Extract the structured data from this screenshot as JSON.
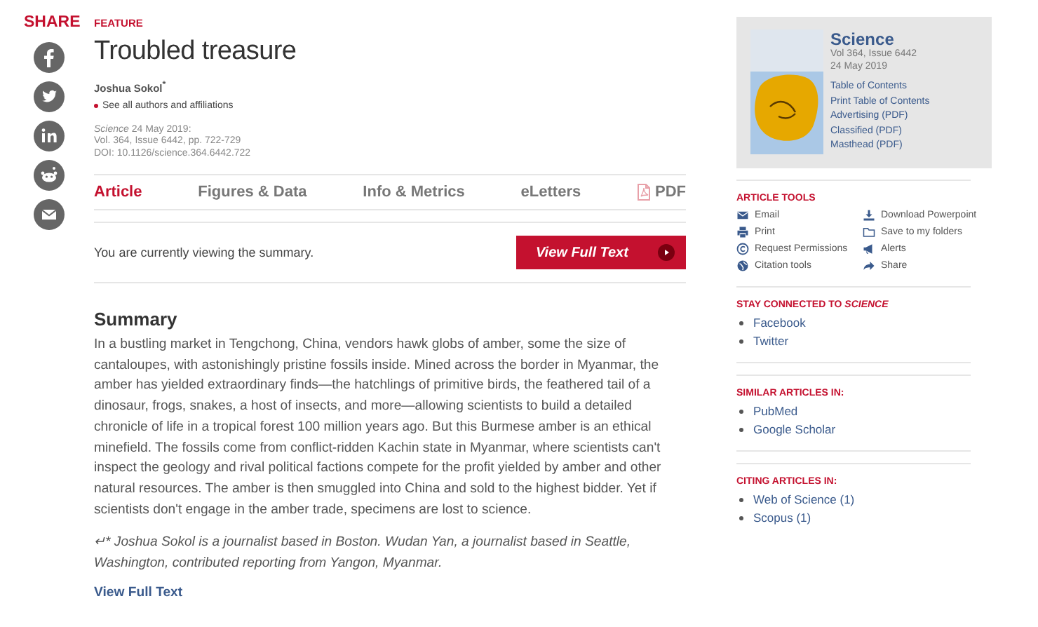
{
  "share": {
    "title": "SHARE"
  },
  "article": {
    "label": "FEATURE",
    "title": "Troubled treasure",
    "author": "Joshua Sokol$^{*}$",
    "affiliations_link": "See all authors and affiliations",
    "citation": [
      "*Science*  24 May 2019:",
      "Vol. 364, Issue 6442, pp. 722-729",
      "DOI: 10.1126/science.364.6442.722"
    ]
  },
  "tabs": [
    {
      "label": "Article",
      "selected": true,
      "kind": "text"
    },
    {
      "label": "Figures & Data",
      "selected": false,
      "kind": "text"
    },
    {
      "label": "Info & Metrics",
      "selected": false,
      "kind": "text"
    },
    {
      "label": "eLetters",
      "selected": false,
      "kind": "text"
    },
    {
      "label": "PDF",
      "selected": false,
      "kind": "pdf"
    }
  ],
  "summary_notice": {
    "text": "You are currently viewing the summary.",
    "button": "View Full Text"
  },
  "summary": {
    "heading": "Summary",
    "body": "In a bustling market in Tengchong, China, vendors hawk globs of amber, some the size of cantaloupes, with astonishingly pristine fossils inside. Mined across the border in Myanmar, the amber has yielded extraordinary finds—the hatchlings of primitive birds, the feathered tail of a dinosaur, frogs, snakes, a host of insects, and more—allowing scientists to build a detailed chronicle of life in a tropical forest 100 million years ago. But this Burmese amber is an ethical minefield. The fossils come from conflict-ridden Kachin state in Myanmar, where scientists can't inspect the geology and rival political factions compete for the profit yielded by amber and other natural resources. The amber is then smuggled into China and sold to the highest bidder. Yet if scientists don't engage in the amber trade, specimens are lost to science.",
    "note": "↵* Joshua Sokol is a journalist based in Boston. Wudan Yan, a journalist based in Seattle, Washington, contributed reporting from Yangon, Myanmar.",
    "full_text_link": "View Full Text"
  },
  "issue": {
    "journal": "Science",
    "volume": "Vol 364, Issue 6442",
    "date": "24 May 2019",
    "links": [
      "Table of Contents",
      "Print Table of Contents",
      "Advertising (PDF)",
      "Classified (PDF)",
      "Masthead (PDF)"
    ]
  },
  "article_tools": {
    "heading": "ARTICLE TOOLS",
    "items": [
      "Email",
      "Download Powerpoint",
      "Print",
      "Save to my folders",
      "Request Permissions",
      "Alerts",
      "Citation tools",
      "Share"
    ]
  },
  "sections": [
    {
      "heading": "STAY CONNECTED TO *SCIENCE*",
      "items": [
        "Facebook",
        "Twitter"
      ]
    },
    {
      "heading": "SIMILAR ARTICLES IN:",
      "items": [
        "PubMed",
        "Google Scholar"
      ]
    },
    {
      "heading": "CITING ARTICLES IN:",
      "items": [
        "Web of Science (1)",
        "Scopus (1)"
      ]
    }
  ]
}
